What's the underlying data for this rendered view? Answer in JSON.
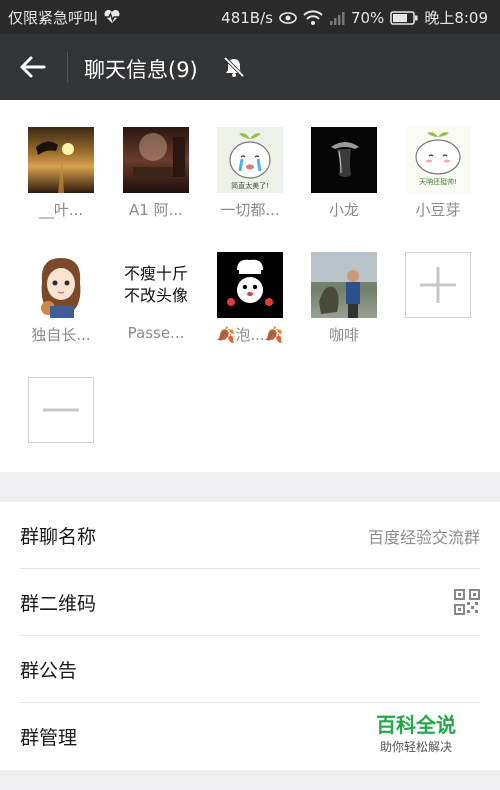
{
  "status_bar": {
    "carrier": "仅限紧急呼叫",
    "speed": "481B/s",
    "battery": "70%",
    "time": "晚上8:09"
  },
  "app_bar": {
    "title": "聊天信息(9)"
  },
  "members": [
    {
      "name": "__叶..."
    },
    {
      "name": "A1  阿..."
    },
    {
      "name": "一切都..."
    },
    {
      "name": "小龙"
    },
    {
      "name": "小豆芽"
    },
    {
      "name": "独自长..."
    },
    {
      "name": "Passe..."
    },
    {
      "name": "泡..."
    },
    {
      "name": "咖啡"
    }
  ],
  "member_avatar_texts": {
    "passe_line1": "不瘦十斤",
    "passe_line2": "不改头像",
    "sticker1": "简直太美了!",
    "sticker2": "天呐还挺帅!"
  },
  "settings": {
    "group_name_label": "群聊名称",
    "group_name_value": "百度经验交流群",
    "qr_label": "群二维码",
    "notice_label": "群公告",
    "manage_label": "群管理"
  },
  "watermark": {
    "title": "百科全说",
    "subtitle": "助你轻松解决"
  },
  "colors": {
    "app_bar": "#333437",
    "status_bar": "#2a2a2a",
    "watermark_green": "#22a84a"
  }
}
